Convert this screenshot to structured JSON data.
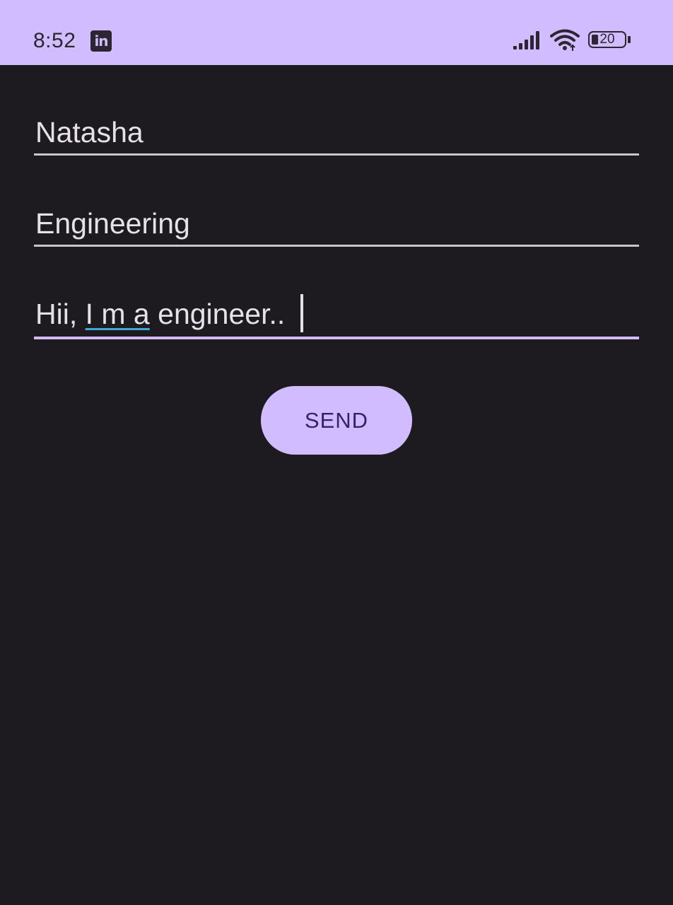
{
  "status_bar": {
    "time": "8:52",
    "notification_icon": "linkedin-icon",
    "notification_icon_text": "in",
    "signal_icon": "signal-bars-icon",
    "wifi_icon": "wifi-icon",
    "battery_level": "20",
    "background": "#d0bcff"
  },
  "form": {
    "name_field": {
      "value": "Natasha"
    },
    "department_field": {
      "value": "Engineering"
    },
    "message_field": {
      "value_before": "Hii, ",
      "value_underlined": "I m a",
      "value_after": " engineer.. "
    },
    "send_button": {
      "label": "SEND"
    }
  },
  "colors": {
    "app_background": "#1d1b20",
    "accent": "#d0bcff",
    "button_text": "#381e72",
    "text": "#e6e0e9",
    "spellcheck_underline": "#3fa9d9"
  }
}
